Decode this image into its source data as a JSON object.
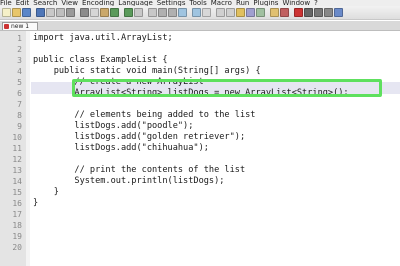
{
  "menubar": {
    "items": [
      "File",
      "Edit",
      "Search",
      "View",
      "Encoding",
      "Language",
      "Settings",
      "Tools",
      "Macro",
      "Run",
      "Plugins",
      "Window",
      "?"
    ]
  },
  "toolbar": {
    "buttons": [
      {
        "name": "new-file-icon",
        "color": "#f5f0c8"
      },
      {
        "name": "open-file-icon",
        "color": "#e8c66a"
      },
      {
        "name": "save-icon",
        "color": "#5a86c9"
      },
      {
        "name": "save-all-icon",
        "color": "#4f77b8"
      },
      {
        "name": "close-icon",
        "color": "#c9c9c9"
      },
      {
        "name": "close-all-icon",
        "color": "#bfbfbf"
      },
      {
        "name": "print-icon",
        "color": "#9a9a9a"
      },
      {
        "name": "cut-icon",
        "color": "#8c8c8c"
      },
      {
        "name": "copy-icon",
        "color": "#d6d6d6"
      },
      {
        "name": "paste-icon",
        "color": "#caa86a"
      },
      {
        "name": "undo-icon",
        "color": "#5a9a5a"
      },
      {
        "name": "redo-icon",
        "color": "#5a9a5a"
      },
      {
        "name": "find-icon",
        "color": "#c8c8c8"
      },
      {
        "name": "replace-icon",
        "color": "#c8c8c8"
      },
      {
        "name": "zoom-in-icon",
        "color": "#b0b0b0"
      },
      {
        "name": "zoom-out-icon",
        "color": "#b0b0b0"
      },
      {
        "name": "sync-v-icon",
        "color": "#9fc4e0"
      },
      {
        "name": "sync-h-icon",
        "color": "#9fc4e0"
      },
      {
        "name": "word-wrap-icon",
        "color": "#d8d8d8"
      },
      {
        "name": "show-all-icon",
        "color": "#d0d0d0"
      },
      {
        "name": "indent-guide-icon",
        "color": "#d0d0d0"
      },
      {
        "name": "udl-icon",
        "color": "#e0c060"
      },
      {
        "name": "doc-map-icon",
        "color": "#a0a0d0"
      },
      {
        "name": "function-list-icon",
        "color": "#a0c0a0"
      },
      {
        "name": "folder-workspace-icon",
        "color": "#e0c070"
      },
      {
        "name": "monitoring-icon",
        "color": "#c06060"
      },
      {
        "name": "record-macro-icon",
        "color": "#cc3333"
      },
      {
        "name": "stop-macro-icon",
        "color": "#666666"
      },
      {
        "name": "play-macro-icon",
        "color": "#777777"
      },
      {
        "name": "run-macro-icon",
        "color": "#888888"
      },
      {
        "name": "save-macro-icon",
        "color": "#6a8ac9"
      }
    ]
  },
  "tab": {
    "label": "new 1"
  },
  "editor": {
    "lines": [
      {
        "num": "1",
        "text": "import java.util.ArrayList;"
      },
      {
        "num": "2",
        "text": ""
      },
      {
        "num": "3",
        "text": "public class ExampleList {"
      },
      {
        "num": "4",
        "text": "    public static void main(String[] args) {"
      },
      {
        "num": "5",
        "text": "        // create a new ArrayList"
      },
      {
        "num": "6",
        "text": "        ArrayList<String> listDogs = new ArrayList<String>();"
      },
      {
        "num": "7",
        "text": ""
      },
      {
        "num": "8",
        "text": "        // elements being added to the list"
      },
      {
        "num": "9",
        "text": "        listDogs.add(\"poodle\");"
      },
      {
        "num": "10",
        "text": "        listDogs.add(\"golden retriever\");"
      },
      {
        "num": "11",
        "text": "        listDogs.add(\"chihuahua\");"
      },
      {
        "num": "12",
        "text": ""
      },
      {
        "num": "13",
        "text": "        // print the contents of the list"
      },
      {
        "num": "14",
        "text": "        System.out.println(listDogs);"
      },
      {
        "num": "15",
        "text": "    }"
      },
      {
        "num": "16",
        "text": "}"
      },
      {
        "num": "17",
        "text": ""
      },
      {
        "num": "18",
        "text": ""
      },
      {
        "num": "19",
        "text": ""
      },
      {
        "num": "20",
        "text": ""
      }
    ],
    "highlight_color": "#5ee05e",
    "caret_color": "#e03030"
  }
}
